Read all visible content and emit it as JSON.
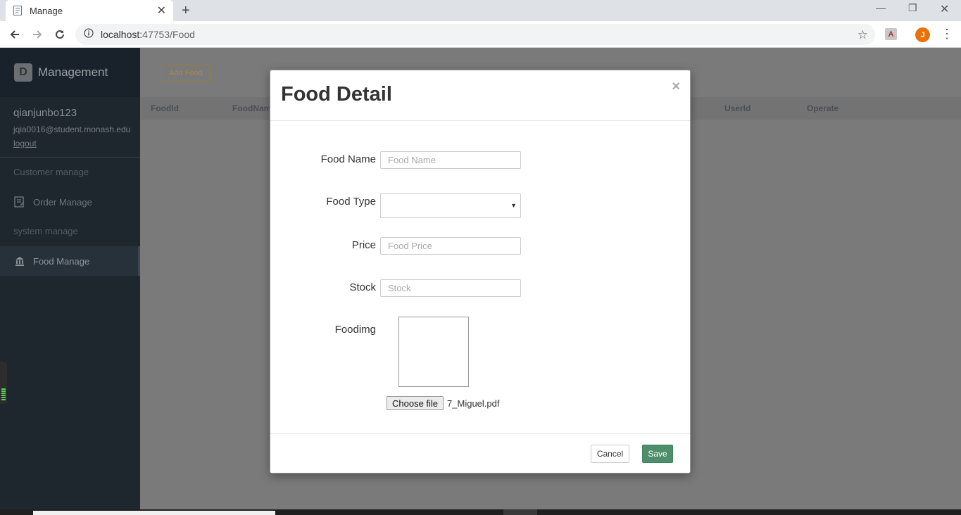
{
  "browser": {
    "tab_title": "Manage",
    "url_host": "localhost:",
    "url_path": "47753/Food",
    "avatar_letter": "J",
    "pdf_ext_letter": "A"
  },
  "sidebar": {
    "brand_logo_letter": "D",
    "brand": "Management",
    "username": "qianjunbo123",
    "email": "jqia0016@student.monash.edu",
    "logout": "logout",
    "groups": [
      {
        "label": "Customer manage"
      },
      {
        "label": "system manage"
      }
    ],
    "items": [
      {
        "label": "Order Manage",
        "icon": "order-icon"
      },
      {
        "label": "Food Manage",
        "icon": "bank-icon",
        "active": true
      }
    ]
  },
  "main": {
    "add_button": "Add Food",
    "columns": [
      "FoodId",
      "FoodNam",
      "UserId",
      "Operate"
    ]
  },
  "modal": {
    "title": "Food Detail",
    "close": "×",
    "fields": {
      "food_name_label": "Food Name",
      "food_name_placeholder": "Food Name",
      "food_type_label": "Food Type",
      "food_type_value": "",
      "price_label": "Price",
      "price_placeholder": "Food Price",
      "stock_label": "Stock",
      "stock_placeholder": "Stock",
      "foodimg_label": "Foodimg"
    },
    "file": {
      "button": "Choose file",
      "name": "7_Miguel.pdf"
    },
    "cancel": "Cancel",
    "save": "Save"
  },
  "colors": {
    "sidebar_bg": "#1e262e",
    "overlay": "#7a7a7a",
    "save_btn": "#4e8e6a",
    "add_btn": "#a8874a"
  }
}
